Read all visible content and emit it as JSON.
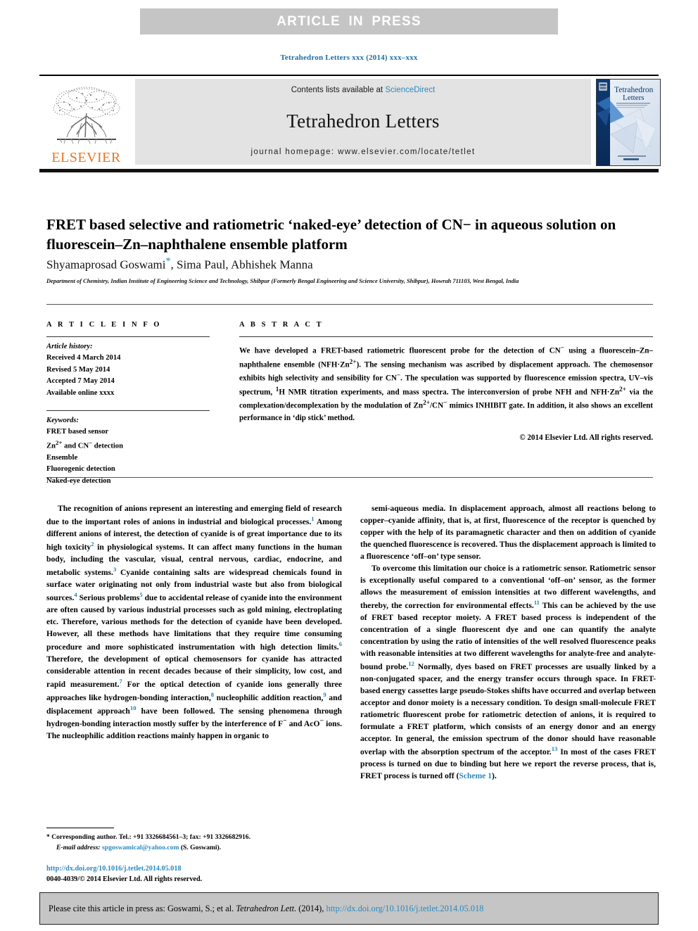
{
  "banner": {
    "text": "ARTICLE  IN  PRESS"
  },
  "journal_ref": "Tetrahedron Letters xxx (2014) xxx–xxx",
  "masthead": {
    "contents_prefix": "Contents lists available at ",
    "sciencedirect": "ScienceDirect",
    "journal_name": "Tetrahedron Letters",
    "homepage": "journal homepage: www.elsevier.com/locate/tetlet",
    "publisher_wordmark": "ELSEVIER",
    "cover_title_line1": "Tetrahedron",
    "cover_title_line2": "Letters"
  },
  "article": {
    "title": "FRET based selective and ratiometric ‘naked-eye’ detection of CN− in aqueous solution on fluorescein–Zn–naphthalene ensemble platform",
    "authors": "Shyamaprosad Goswami",
    "authors_rest": ", Sima Paul, Abhishek Manna",
    "corresponding_marker": "*",
    "affiliation": "Department of Chemistry, Indian Institute of Engineering Science and Technology, Shibpur (Formerly Bengal Engineering and Science University, Shibpur), Howrah 711103, West Bengal, India"
  },
  "article_info": {
    "heading": "A R T I C L E   I N F O",
    "history_label": "Article history:",
    "history": [
      "Received 4 March 2014",
      "Revised 5 May 2014",
      "Accepted 7 May 2014",
      "Available online xxxx"
    ],
    "keywords_label": "Keywords:",
    "keywords": [
      "FRET based sensor",
      "Zn2+ and CN− detection",
      "Ensemble",
      "Fluorogenic detection",
      "Naked-eye detection"
    ]
  },
  "abstract": {
    "heading": "A B S T R A C T",
    "text": "We have developed a FRET-based ratiometric fluorescent probe for the detection of CN− using a fluorescein–Zn–naphthalene ensemble (NFH·Zn2+). The sensing mechanism was ascribed by displacement approach. The chemosensor exhibits high selectivity and sensibility for CN−. The speculation was supported by fluorescence emission spectra, UV–vis spectrum, 1H NMR titration experiments, and mass spectra. The interconversion of probe NFH and NFH·Zn2+ via the complexation/decomplexation by the modulation of Zn2+/CN− mimics INHIBIT gate. In addition, it also shows an excellent performance in ‘dip stick’ method.",
    "copyright": "© 2014 Elsevier Ltd. All rights reserved."
  },
  "body": {
    "left_paragraph_1": "The recognition of anions represent an interesting and emerging field of research due to the important roles of anions in industrial and biological processes.1 Among different anions of interest, the detection of cyanide is of great importance due to its high toxicity2 in physiological systems. It can affect many functions in the human body, including the vascular, visual, central nervous, cardiac, endocrine, and metabolic systems.3 Cyanide containing salts are widespread chemicals found in surface water originating not only from industrial waste but also from biological sources.4 Serious problems5 due to accidental release of cyanide into the environment are often caused by various industrial processes such as gold mining, electroplating etc. Therefore, various methods for the detection of cyanide have been developed. However, all these methods have limitations that they require time consuming procedure and more sophisticated instrumentation with high detection limits.6 Therefore, the development of optical chemosensors for cyanide has attracted considerable attention in recent decades because of their simplicity, low cost, and rapid measurement.7 For the optical detection of cyanide ions generally three approaches like hydrogen-bonding interaction,8 nucleophilic addition reaction,9 and displacement approach10 have been followed. The sensing phenomena through hydrogen-bonding interaction mostly suffer by the interference of F− and AcO− ions. The nucleophilic addition reactions mainly happen in organic to",
    "right_paragraph_1": "semi-aqueous media. In displacement approach, almost all reactions belong to copper–cyanide affinity, that is, at first, fluorescence of the receptor is quenched by copper with the help of its paramagnetic character and then on addition of cyanide the quenched fluorescence is recovered. Thus the displacement approach is limited to a fluorescence ‘off–on’ type sensor.",
    "right_paragraph_2": "To overcome this limitation our choice is a ratiometric sensor. Ratiometric sensor is exceptionally useful compared to a conventional ‘off–on’ sensor, as the former allows the measurement of emission intensities at two different wavelengths, and thereby, the correction for environmental effects.11 This can be achieved by the use of FRET based receptor moiety. A FRET based process is independent of the concentration of a single fluorescent dye and one can quantify the analyte concentration by using the ratio of intensities of the well resolved fluorescence peaks with reasonable intensities at two different wavelengths for analyte-free and analyte-bound probe.12 Normally, dyes based on FRET processes are usually linked by a non-conjugated spacer, and the energy transfer occurs through space. In FRET-based energy cassettes large pseudo-Stokes shifts have occurred and overlap between acceptor and donor moiety is a necessary condition. To design small-molecule FRET ratiometric fluorescent probe for ratiometric detection of anions, it is required to formulate a FRET platform, which consists of an energy donor and an energy acceptor. In general, the emission spectrum of the donor should have reasonable overlap with the absorption spectrum of the acceptor.13 In most of the cases FRET process is turned on due to binding but here we report the reverse process, that is, FRET process is turned off (Scheme 1).",
    "scheme_link": "Scheme 1"
  },
  "footnote": {
    "corresponding": "* Corresponding author. Tel.: +91 3326684561–3; fax: +91 3326682916.",
    "email_label": "E-mail address:",
    "email": "spgoswamical@yahoo.com",
    "email_suffix": "(S. Goswami).",
    "doi_url": "http://dx.doi.org/10.1016/j.tetlet.2014.05.018",
    "issn_line": "0040-4039/© 2014 Elsevier Ltd. All rights reserved."
  },
  "citation_footer": {
    "prefix": "Please cite this article in press as: Goswami, S.; et al. ",
    "journal_italic": "Tetrahedron Lett.",
    "year": " (2014), ",
    "doi": "http://dx.doi.org/10.1016/j.tetlet.2014.05.018"
  },
  "colors": {
    "band_gray": "#c5c5c5",
    "masthead_gray": "#e3e3e3",
    "link_blue": "#2a8ac0",
    "ref_blue": "#1a7fb5",
    "elsevier_orange": "#E87722"
  }
}
